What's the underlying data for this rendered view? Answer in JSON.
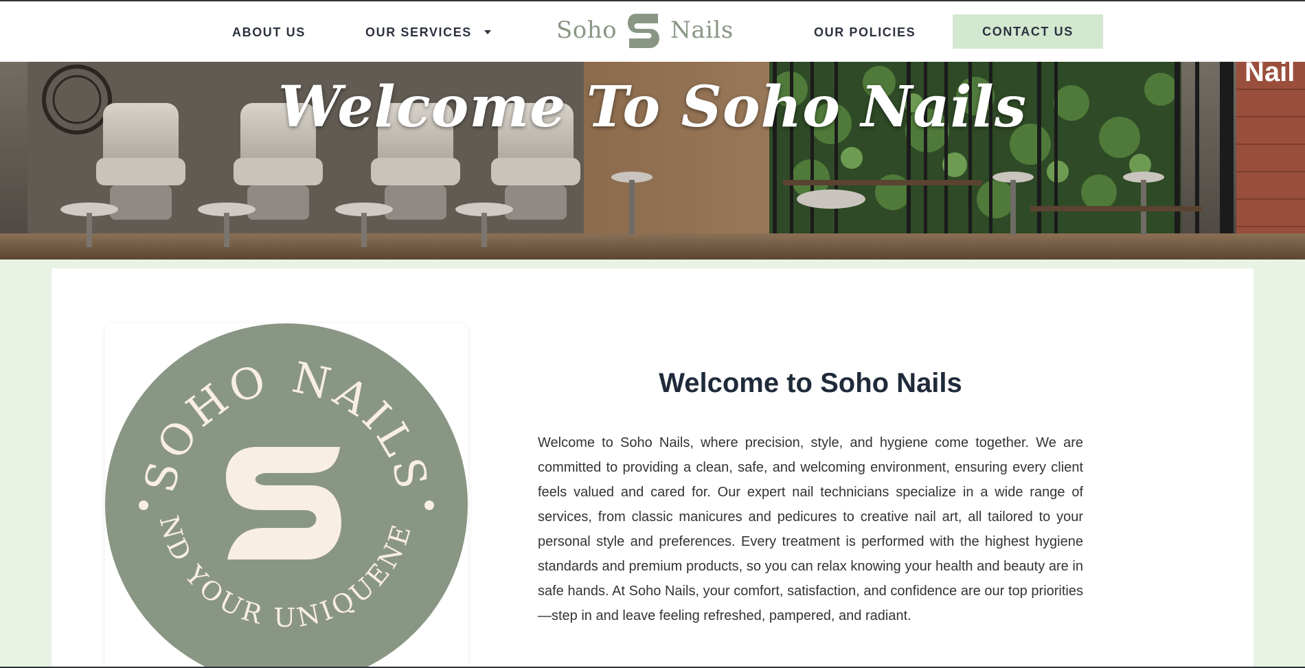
{
  "header": {
    "nav": {
      "about": "ABOUT US",
      "services": "OUR SERVICES",
      "policies": "OUR POLICIES",
      "contact": "CONTACT US"
    },
    "logo": {
      "left_word": "Soho",
      "right_word": "Nails"
    }
  },
  "hero": {
    "title": "Welcome To Soho Nails",
    "sign_fragment": "Nail"
  },
  "emblem": {
    "top_text": "SOHO NAILS",
    "bottom_text": "FIND YOUR UNIQUENESS"
  },
  "main": {
    "heading": "Welcome to Soho Nails",
    "body": "Welcome to Soho Nails, where precision, style, and hygiene come together. We are committed to providing a clean, safe, and welcoming environment, ensuring every client feels valued and cared for. Our expert nail technicians specialize in a wide range of services, from classic manicures and pedicures to creative nail art, all tailored to your personal style and preferences. Every treatment is performed with the highest hygiene standards and premium products, so you can relax knowing your health and beauty are in safe hands. At Soho Nails, your comfort, satisfaction, and confidence are our top priorities—step in and leave feeling refreshed, pampered, and radiant."
  },
  "colors": {
    "brand_sage": "#8a9684",
    "cream": "#f8eee3",
    "button_green": "#d2e8cf",
    "page_bg": "#e8f3e3",
    "heading_navy": "#1f2a3a"
  },
  "icons": {
    "dropdown": "caret-down-icon",
    "logo_mark": "s-logo-icon"
  }
}
